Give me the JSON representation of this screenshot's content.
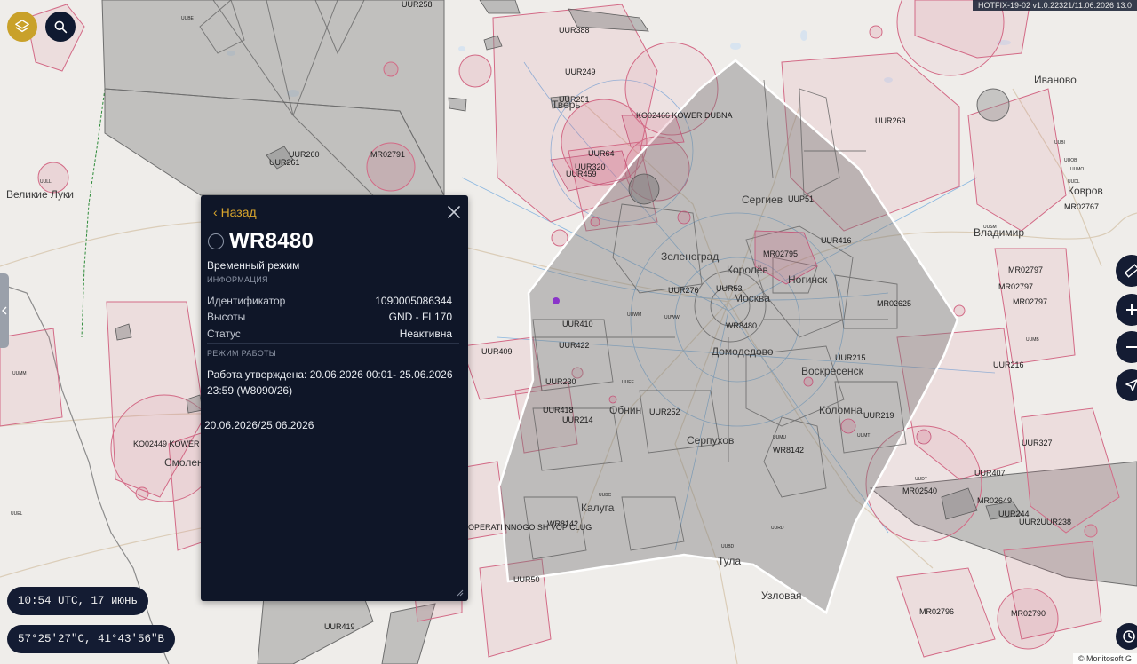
{
  "map": {
    "cities": [
      "Великие Луки",
      "Смолен",
      "Калуга",
      "Тула",
      "Узловая",
      "Серпухов",
      "Обнин",
      "Коломна",
      "Воскресенск",
      "Домодедово",
      "Москва",
      "Королёв",
      "Зеленоград",
      "Сергиев",
      "Ногинск",
      "Владимир",
      "Ковров",
      "Иваново",
      "Тверь"
    ],
    "zones": [
      "UUR258",
      "UUR388",
      "UUR249",
      "UUR251",
      "KO02466 KOWER DUBNA",
      "UUR64",
      "UUR320",
      "UUR459",
      "UUR260",
      "UUR261",
      "MR02791",
      "UUR269",
      "UUP51",
      "UUR416",
      "MR02795",
      "MR02625",
      "UUR276",
      "UUR53",
      "WR8480",
      "UUR410",
      "UUR422",
      "UUR409",
      "UUR230",
      "UUR418",
      "UUR214",
      "UUR252",
      "UUR215",
      "UUR219",
      "WR8142",
      "UUR216",
      "UUR327",
      "UUR407",
      "MR02540",
      "MR02649",
      "UUR244",
      "UUR2UUR238",
      "MR02796",
      "MR02790",
      "UUR419",
      "OPERATI NNOGO SH VOP CLUG",
      "WR8142",
      "KO02449 KOWER",
      "MR02797",
      "MR02797",
      "MR02797",
      "MR02767",
      "UUR50"
    ],
    "small_labels": [
      "UUMM",
      "UULL",
      "UUEL",
      "UUMT",
      "UUEE",
      "UUMU",
      "UUBC",
      "UUBD",
      "UUDT",
      "UUSM",
      "UUWW",
      "UUWM",
      "UUMB",
      "UUDL",
      "UUBI",
      "UUOB",
      "UUBE",
      "UUMO",
      "UURD"
    ]
  },
  "toolbar": {
    "layers_icon": "layers-icon",
    "search_icon": "search-icon"
  },
  "version_text": "HOTFIX-19-02 v1.0.22321/11.06.2026 13:0",
  "copyright_text": "© Monitosoft G",
  "panel": {
    "back_label": "Назад",
    "title": "WR8480",
    "zone_type": "Временный режим",
    "info_heading": "ИНФОРМАЦИЯ",
    "rows": [
      {
        "label": "Идентификатор",
        "value": "1090005086344"
      },
      {
        "label": "Высоты",
        "value": "GND - FL170"
      },
      {
        "label": "Статус",
        "value": "Неактивна"
      }
    ],
    "schedule_heading": "РЕЖИМ РАБОТЫ",
    "schedule_text": "Работа утверждена: 20.06.2026 00:01- 25.06.2026 23:59 (W8090/26)",
    "dates_text": "20.06.2026/25.06.2026"
  },
  "status_bar": {
    "time": "10:54 UTC, 17 июнь",
    "coordinates": "57°25′27″С, 41°43′56″В"
  },
  "colors": {
    "panel_bg": "#0f1628",
    "accent": "#d9a52c",
    "zone_pink": "#d36a86",
    "zone_gray": "#7c7c7c",
    "map_bg": "#efedea"
  }
}
